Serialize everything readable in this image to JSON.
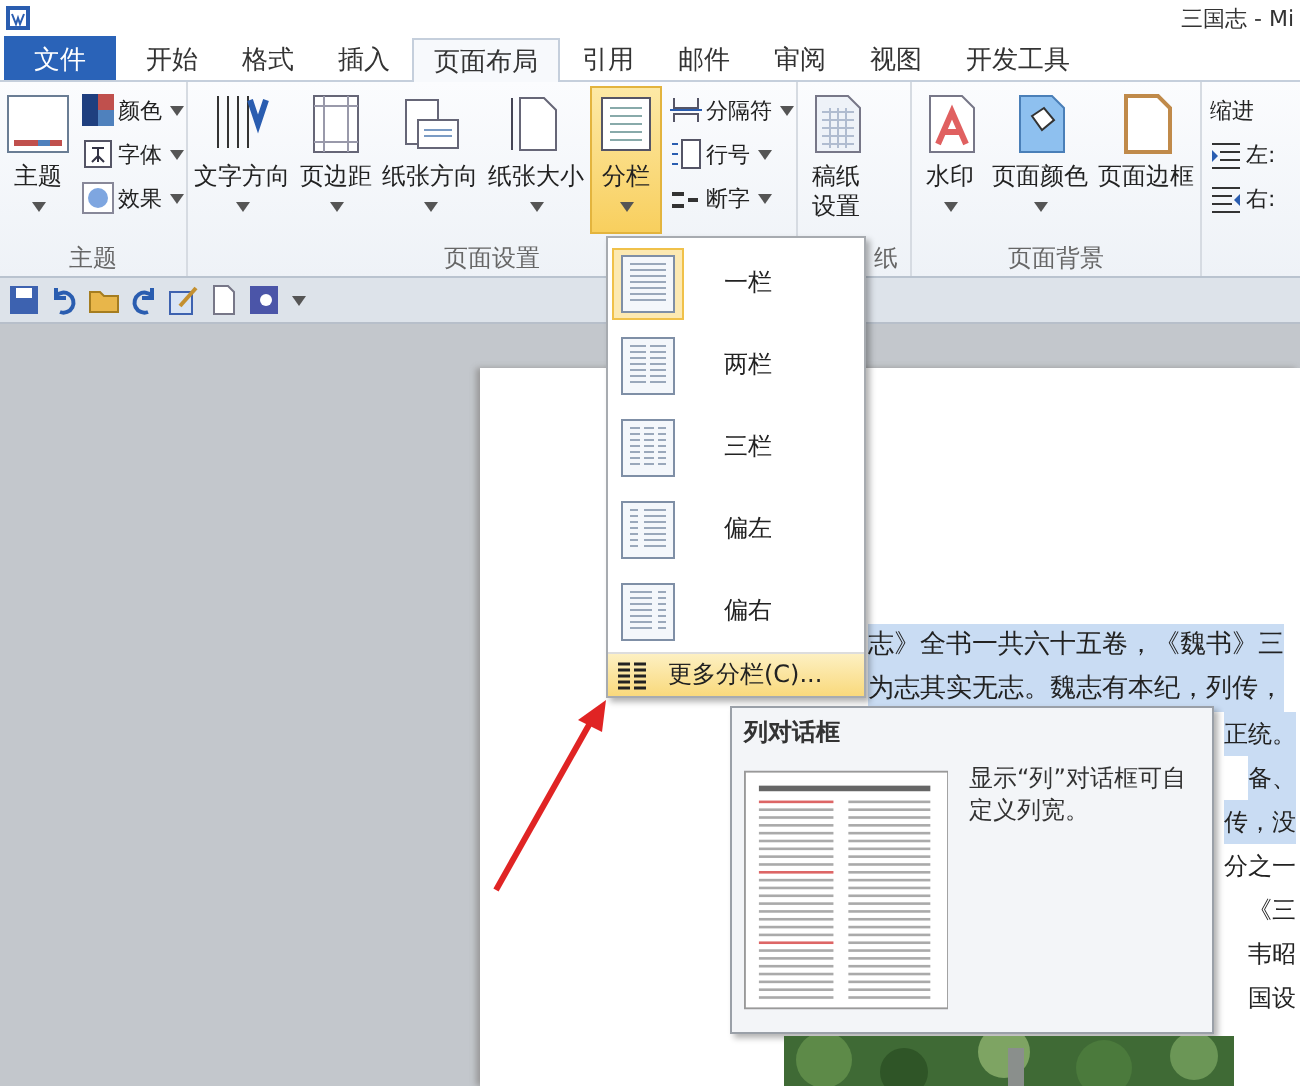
{
  "window": {
    "title": "三国志 - Mi"
  },
  "tabs": [
    {
      "label": "文件",
      "kind": "file",
      "selected": false
    },
    {
      "label": "开始",
      "kind": "tab",
      "selected": false
    },
    {
      "label": "格式",
      "kind": "tab",
      "selected": false
    },
    {
      "label": "插入",
      "kind": "tab",
      "selected": false
    },
    {
      "label": "页面布局",
      "kind": "tab",
      "selected": true
    },
    {
      "label": "引用",
      "kind": "tab",
      "selected": false
    },
    {
      "label": "邮件",
      "kind": "tab",
      "selected": false
    },
    {
      "label": "审阅",
      "kind": "tab",
      "selected": false
    },
    {
      "label": "视图",
      "kind": "tab",
      "selected": false
    },
    {
      "label": "开发工具",
      "kind": "tab",
      "selected": false
    }
  ],
  "ribbon": {
    "groups": [
      {
        "label": "主题",
        "buttons": [
          {
            "kind": "big",
            "label": "主题",
            "dropdown": true,
            "pressed": false
          },
          {
            "kind": "stack",
            "items": [
              {
                "label": "颜色",
                "dropdown": true
              },
              {
                "label": "字体",
                "dropdown": true
              },
              {
                "label": "效果",
                "dropdown": true
              }
            ]
          }
        ]
      },
      {
        "label": "页面设置",
        "buttons": [
          {
            "kind": "big",
            "label": "文字方向",
            "dropdown": true,
            "pressed": false
          },
          {
            "kind": "big",
            "label": "页边距",
            "dropdown": true,
            "pressed": false
          },
          {
            "kind": "big",
            "label": "纸张方向",
            "dropdown": true,
            "pressed": false
          },
          {
            "kind": "big",
            "label": "纸张大小",
            "dropdown": true,
            "pressed": false
          },
          {
            "kind": "big",
            "label": "分栏",
            "dropdown": true,
            "pressed": true
          },
          {
            "kind": "stack",
            "items": [
              {
                "label": "分隔符",
                "dropdown": true
              },
              {
                "label": "行号",
                "dropdown": true
              },
              {
                "label": "断字",
                "dropdown": true
              }
            ]
          }
        ]
      },
      {
        "label": "纸",
        "buttons": [
          {
            "kind": "tall",
            "label": "稿纸设置",
            "dropdown": false,
            "pressed": false
          }
        ]
      },
      {
        "label": "页面背景",
        "buttons": [
          {
            "kind": "big",
            "label": "水印",
            "dropdown": true,
            "pressed": false
          },
          {
            "kind": "big",
            "label": "页面颜色",
            "dropdown": true,
            "pressed": false
          },
          {
            "kind": "big",
            "label": "页面边框",
            "dropdown": false,
            "pressed": false
          }
        ]
      },
      {
        "buttons": [
          {
            "kind": "indent",
            "title": "缩进",
            "items": [
              {
                "label": "左:"
              },
              {
                "label": "右:"
              }
            ]
          }
        ]
      }
    ]
  },
  "document": {
    "lines": [
      {
        "text": "志》全书一共六十五卷，《魏书》三",
        "selected": true
      },
      {
        "text": "为志其实无志。魏志有本纪，列传，",
        "selected": true
      }
    ],
    "fragments": [
      {
        "text": "正统。",
        "selected": true
      },
      {
        "text": "备、",
        "selected": true
      },
      {
        "text": "传，没",
        "selected": true
      },
      {
        "text": "分之一",
        "selected": false
      },
      {
        "text": "《三",
        "selected": false
      },
      {
        "text": "韦昭",
        "selected": false
      },
      {
        "text": "国设",
        "selected": false
      }
    ]
  },
  "columns_menu": {
    "items": [
      {
        "label": "一栏",
        "selected": true
      },
      {
        "label": "两栏",
        "selected": false
      },
      {
        "label": "三栏",
        "selected": false
      },
      {
        "label": "偏左",
        "selected": false
      },
      {
        "label": "偏右",
        "selected": false
      }
    ],
    "more": {
      "label": "更多分栏(C)...",
      "hovered": true
    }
  },
  "tooltip": {
    "title": "列对话框",
    "text": "显示“列”对话框可自定义列宽。"
  }
}
